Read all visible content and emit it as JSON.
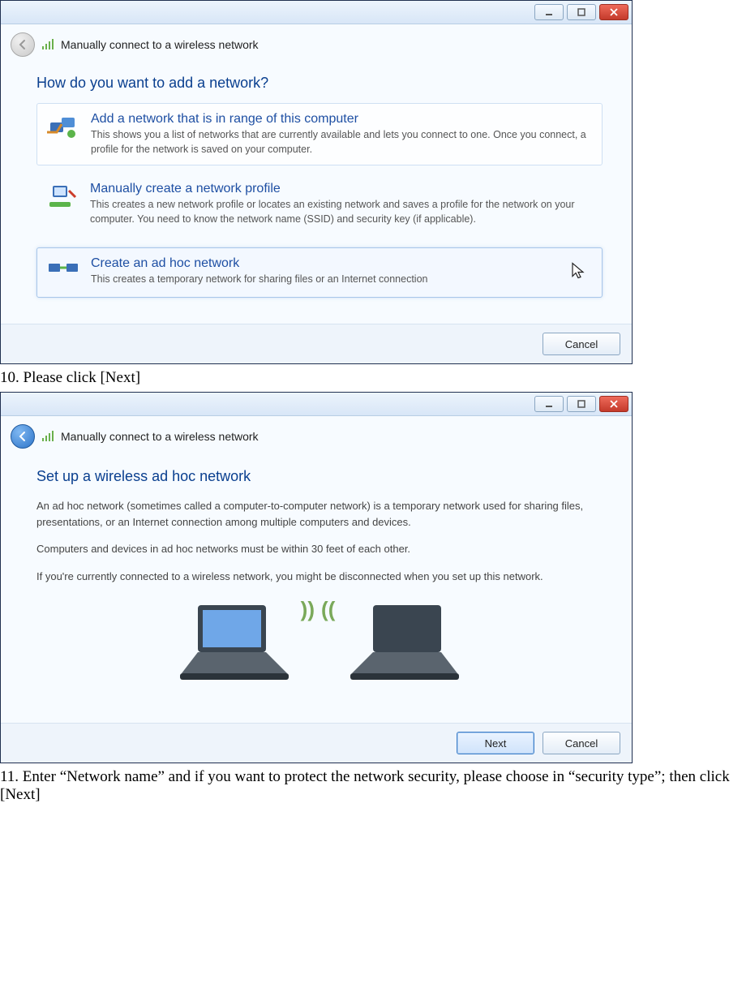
{
  "doc": {
    "step10": "10. Please click [Next]",
    "step11": "11. Enter “Network name” and if you want to protect the network security, please choose in “security type”; then click [Next]"
  },
  "window1": {
    "title": "Manually connect to a wireless network",
    "heading": "How do you want to add a network?",
    "options": [
      {
        "title": "Add a network that is in range of this computer",
        "desc": "This shows you a list of networks that are currently available and lets you connect to one. Once you connect, a profile for the network is saved on your computer."
      },
      {
        "title": "Manually create a network profile",
        "desc": "This creates a new network profile or locates an existing network and saves a profile for the network on your computer. You need to know the network name (SSID) and security key (if applicable)."
      },
      {
        "title": "Create an ad hoc network",
        "desc": "This creates a temporary network for sharing files or an Internet connection"
      }
    ],
    "cancel": "Cancel"
  },
  "window2": {
    "title": "Manually connect to a wireless network",
    "heading": "Set up a wireless ad hoc network",
    "para1": "An ad hoc network (sometimes called a computer-to-computer network) is a temporary network used for sharing files, presentations, or an Internet connection among multiple computers and devices.",
    "para2": "Computers and devices in ad hoc networks must be within 30 feet of each other.",
    "para3": "If you're currently connected to a wireless network, you might be disconnected when you set up this network.",
    "next": "Next",
    "cancel": "Cancel"
  }
}
